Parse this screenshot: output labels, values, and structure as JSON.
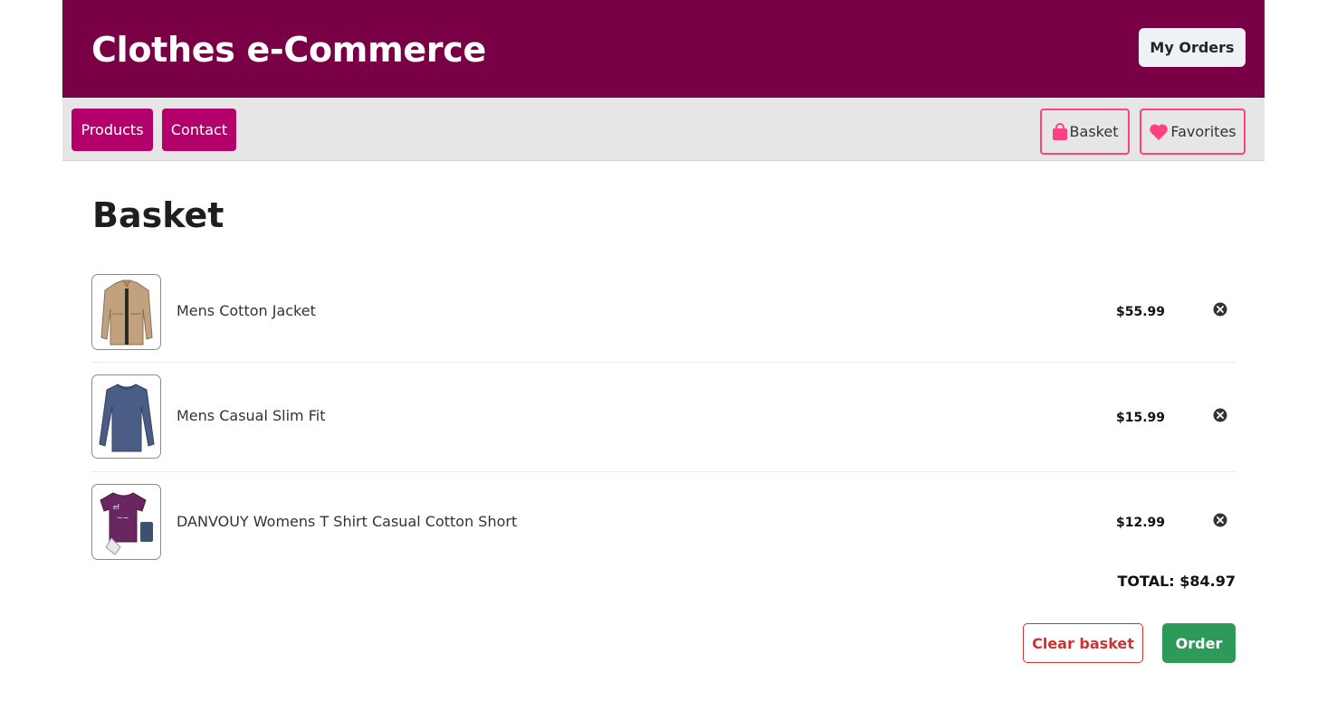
{
  "header": {
    "site_title": "Clothes e-Commerce",
    "my_orders_label": "My Orders"
  },
  "nav": {
    "products_label": "Products",
    "contact_label": "Contact",
    "basket_label": "Basket",
    "favorites_label": "Favorites"
  },
  "page": {
    "heading": "Basket"
  },
  "basket": {
    "items": [
      {
        "name": "Mens Cotton Jacket",
        "price": "$55.99",
        "image": "jacket-image"
      },
      {
        "name": "Mens Casual Slim Fit",
        "price": "$15.99",
        "image": "long-sleeve-shirt-image"
      },
      {
        "name": "DANVOUY Womens T Shirt Casual Cotton Short",
        "price": "$12.99",
        "image": "t-shirt-image"
      }
    ],
    "total_label": "TOTAL: $84.97",
    "clear_label": "Clear basket",
    "order_label": "Order"
  },
  "colors": {
    "header_bg": "#7a0046",
    "nav_button_bg": "#b3006b",
    "accent_pink": "#ff4081",
    "danger": "#cc3333",
    "success": "#2e9a5a"
  }
}
